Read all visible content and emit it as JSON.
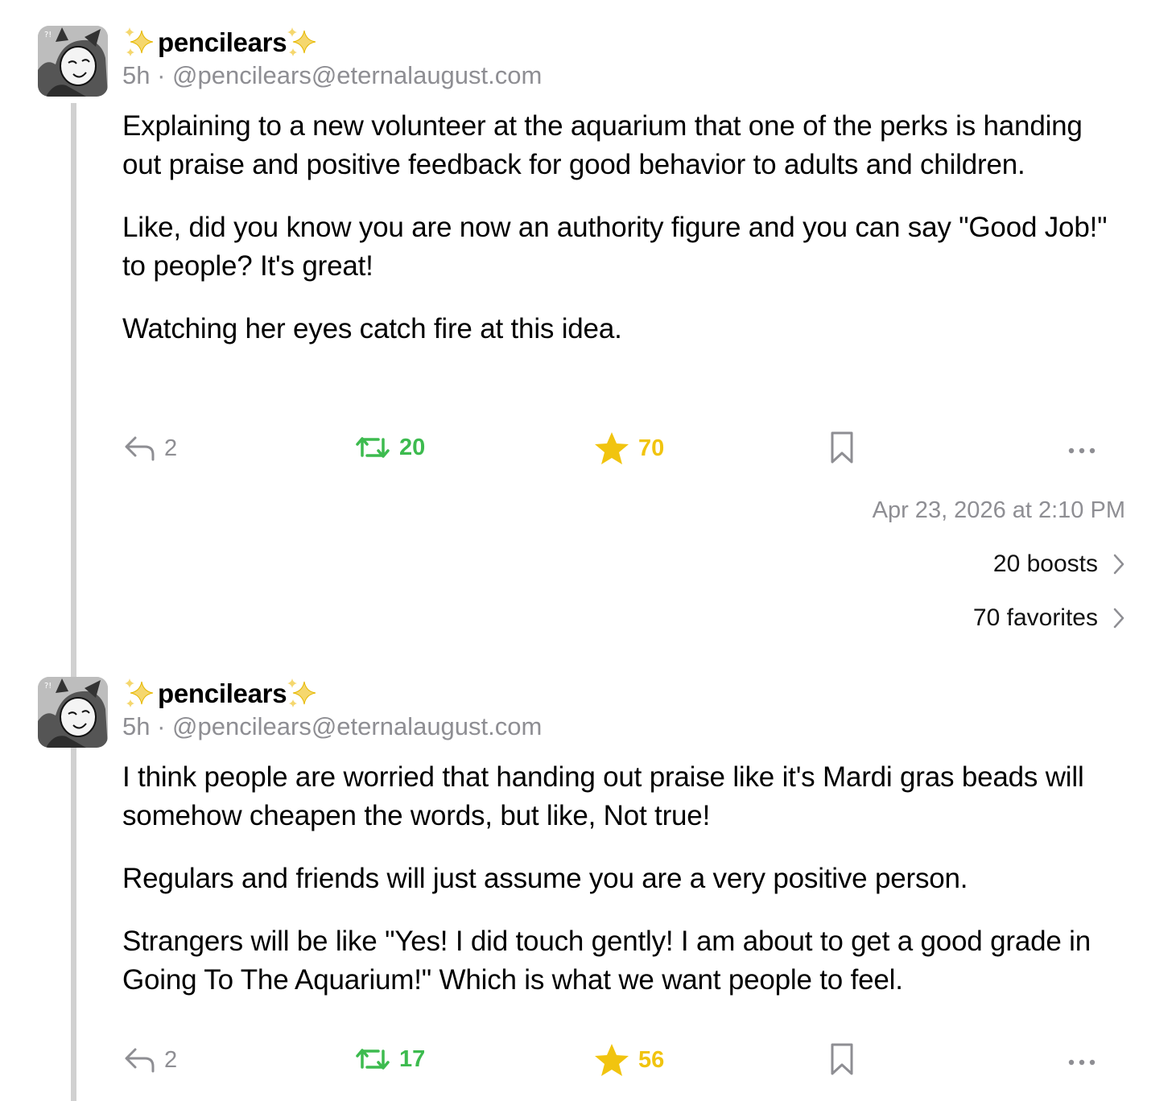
{
  "colors": {
    "muted": "#8e8e93",
    "boost_green": "#3dbb4f",
    "favorite_yellow": "#f1c40f",
    "thread_line": "#d1d1d1"
  },
  "posts": [
    {
      "author": {
        "display_name": "pencilears",
        "time_ago": "5h",
        "separator": "·",
        "handle": "@pencilears@eternalaugust.com",
        "avatar": "avatar-icon",
        "name_decoration": "sparkles-icon"
      },
      "paragraphs": [
        "Explaining to a new volunteer at the aquarium that one of the perks is handing out praise and positive feedback for good behavior to adults and children.",
        "Like, did you know you are now an authority figure and you can say \"Good Job!\" to people? It's great!",
        "Watching her eyes catch fire at this idea."
      ],
      "actions": {
        "replies": "2",
        "boosts": "20",
        "favorites": "70",
        "icons": [
          "reply-icon",
          "boost-icon",
          "star-icon",
          "bookmark-icon",
          "more-icon"
        ]
      },
      "timestamp": "Apr 23, 2026 at 2:10 PM",
      "boosts_link": "20 boosts",
      "favorites_link": "70 favorites"
    },
    {
      "author": {
        "display_name": "pencilears",
        "time_ago": "5h",
        "separator": "·",
        "handle": "@pencilears@eternalaugust.com",
        "avatar": "avatar-icon",
        "name_decoration": "sparkles-icon"
      },
      "paragraphs": [
        "I think people are worried that handing out praise like it's Mardi gras beads will somehow cheapen the words, but like, Not true!",
        "Regulars and friends will just assume you are a very positive person.",
        "Strangers will be like \"Yes! I did touch gently! I am about to get a good grade in Going To The Aquarium!\" Which is what we want people to feel."
      ],
      "actions": {
        "replies": "2",
        "boosts": "17",
        "favorites": "56",
        "icons": [
          "reply-icon",
          "boost-icon",
          "star-icon",
          "bookmark-icon",
          "more-icon"
        ]
      }
    }
  ]
}
